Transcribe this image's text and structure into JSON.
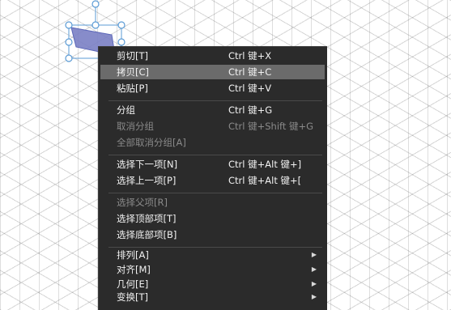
{
  "colors": {
    "menu_bg": "#2b2b2b",
    "highlight": "#6b6b6b",
    "text": "#f2f2f2",
    "disabled_text": "#8a8a8a",
    "selection": "#5b9bd5",
    "shape_fill": "#7a7fc4"
  },
  "canvas": {
    "selected_shape": "parallelogram"
  },
  "menu": {
    "items": [
      {
        "label": "剪切[T]",
        "shortcut": "Ctrl 键+X"
      },
      {
        "label": "拷贝[C]",
        "shortcut": "Ctrl 键+C",
        "highlighted": true
      },
      {
        "label": "粘贴[P]",
        "shortcut": "Ctrl 键+V"
      },
      {
        "label": "分组",
        "shortcut": "Ctrl 键+G"
      },
      {
        "label": "取消分组",
        "shortcut": "Ctrl 键+Shift 键+G",
        "disabled": true
      },
      {
        "label": "全部取消分组[A]",
        "disabled": true
      },
      {
        "label": "选择下一项[N]",
        "shortcut": "Ctrl 键+Alt 键+]"
      },
      {
        "label": "选择上一项[P]",
        "shortcut": "Ctrl 键+Alt 键+["
      },
      {
        "label": "选择父项[R]",
        "disabled": true
      },
      {
        "label": "选择顶部项[T]"
      },
      {
        "label": "选择底部项[B]"
      },
      {
        "label": "排列[A]",
        "submenu": true,
        "arrow": "▶"
      },
      {
        "label": "对齐[M]",
        "submenu": true,
        "arrow": "▶"
      },
      {
        "label": "几何[E]",
        "submenu": true,
        "arrow": "▶"
      },
      {
        "label": "变换[T]",
        "submenu": true,
        "arrow": "▶"
      }
    ]
  }
}
